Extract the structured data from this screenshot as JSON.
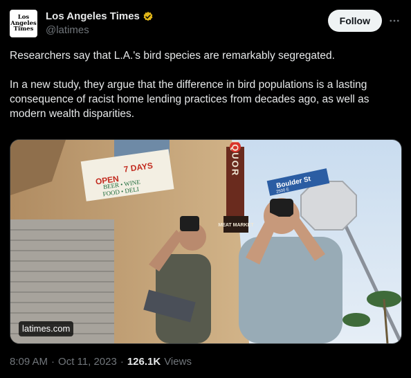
{
  "author": {
    "logo_text": "Los\nAngeles\nTimes",
    "name": "Los Angeles Times",
    "handle": "@latimes",
    "verified": true,
    "verified_color": "#e2b719"
  },
  "actions": {
    "follow_label": "Follow",
    "more_icon": "more-horizontal-icon"
  },
  "tweet": {
    "paragraphs": [
      "Researchers say that L.A.'s bird species are remarkably segregated.",
      "In a new study, they argue that the difference in bird populations is a lasting consequence of racist home lending practices from decades ago, as well as modern wealth disparities."
    ]
  },
  "media": {
    "domain": "latimes.com",
    "sign_store": {
      "top": "7 DAYS",
      "open": "OPEN",
      "line1": "BEER • WINE",
      "line2": "FOOD • DELI"
    },
    "sign_liquor": "LIQUOR",
    "sign_market": "MEAT\nMARKET",
    "street_sign": "Boulder St",
    "street_number": "2500 E"
  },
  "meta": {
    "time": "8:09 AM",
    "separator": "·",
    "date": "Oct 11, 2023",
    "views_count": "126.1K",
    "views_label": "Views"
  }
}
